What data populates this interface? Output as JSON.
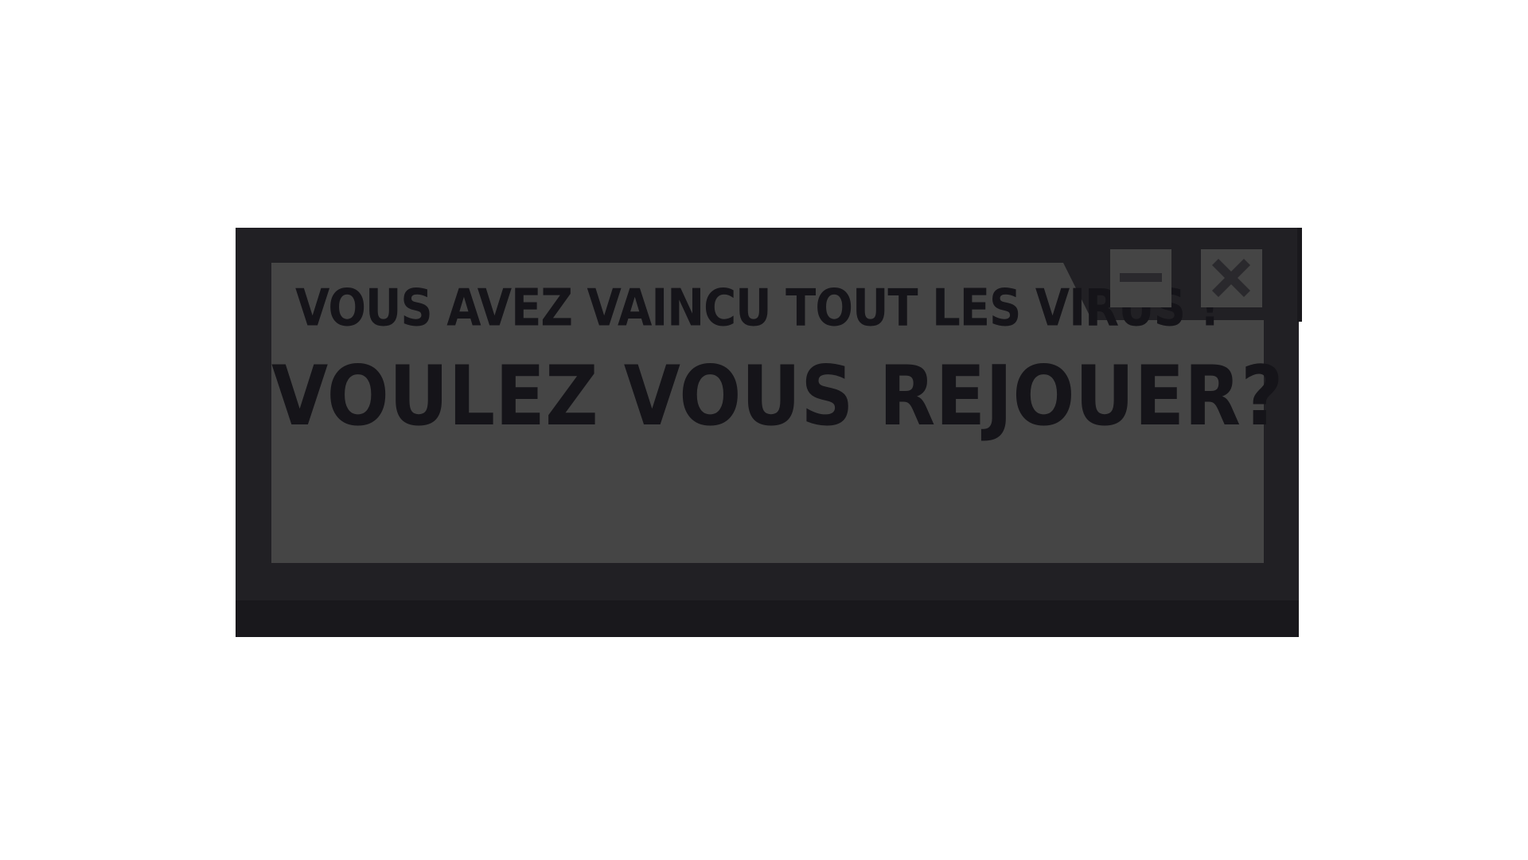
{
  "dialog": {
    "headline": "VOUS AVEZ VAINCU TOUT LES VIRUS !",
    "question": "VOULEZ VOUS REJOUER?"
  },
  "window_controls": {
    "minimize_icon": "minimize-icon",
    "close_icon": "close-icon"
  },
  "colors": {
    "page_background": "#ffffff",
    "frame": "#212024",
    "frame_shadow": "#19181c",
    "panel": "#454545",
    "text": "#151419",
    "icon": "#2a292d"
  }
}
